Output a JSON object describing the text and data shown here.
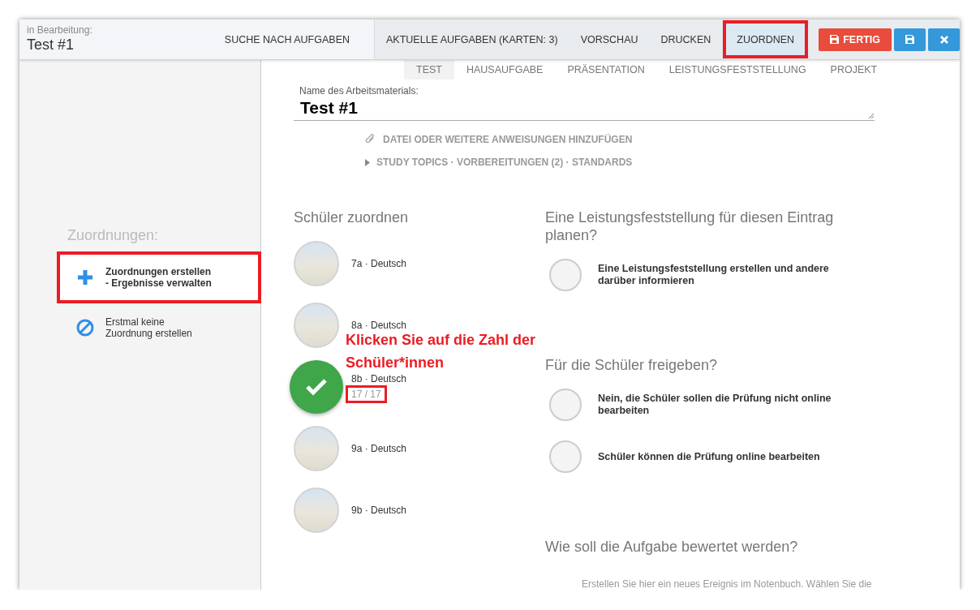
{
  "header": {
    "caption": "in Bearbeitung:",
    "title": "Test #1"
  },
  "nav": [
    {
      "label": "SUCHE NACH AUFGABEN",
      "selected": false,
      "highlighted": false
    },
    {
      "label": "AKTUELLE AUFGABEN (KARTEN: 3)",
      "selected": false,
      "highlighted": false
    },
    {
      "label": "VORSCHAU",
      "selected": false,
      "highlighted": false
    },
    {
      "label": "DRUCKEN",
      "selected": false,
      "highlighted": false
    },
    {
      "label": "ZUORDNEN",
      "selected": true,
      "highlighted": true
    }
  ],
  "actions": [
    {
      "kind": "finish",
      "label": "FERTIG"
    },
    {
      "kind": "save"
    },
    {
      "kind": "close"
    }
  ],
  "subtabs": [
    {
      "label": "TEST",
      "selected": true
    },
    {
      "label": "HAUSAUFGABE",
      "selected": false
    },
    {
      "label": "PRÄSENTATION",
      "selected": false
    },
    {
      "label": "LEISTUNGSFESTSTELLUNG",
      "selected": false
    },
    {
      "label": "PROJEKT",
      "selected": false
    }
  ],
  "material": {
    "label": "Name des Arbeitsmaterials:",
    "value": "Test #1",
    "attach": "DATEI ODER WEITERE ANWEISUNGEN HINZUFÜGEN",
    "topics": "STUDY TOPICS · VORBEREITUNGEN (2) · STANDARDS"
  },
  "sidebar": {
    "heading": "Zuordnungen:",
    "items": [
      {
        "kind": "create",
        "lines": [
          "Zuordnungen erstellen",
          "- Ergebnisse verwalten"
        ],
        "selected": true,
        "highlighted": true
      },
      {
        "kind": "none",
        "lines": [
          "Erstmal keine",
          "Zuordnung erstellen"
        ],
        "selected": false,
        "highlighted": false
      }
    ]
  },
  "students": {
    "heading": "Schüler zuordnen",
    "rows": [
      {
        "label": "7a · Deutsch",
        "selected": false
      },
      {
        "label": "8a · Deutsch",
        "selected": false
      },
      {
        "label": "8b · Deutsch",
        "selected": true,
        "count": "17 / 17",
        "highlighted": true
      },
      {
        "label": "9a · Deutsch",
        "selected": false
      },
      {
        "label": "9b · Deutsch",
        "selected": false
      }
    ]
  },
  "annotation": "Klicken Sie auf die Zahl der Schüler*innen",
  "sections": [
    {
      "heading": "Eine Leistungsfeststellung für diesen Eintrag planen?",
      "options": [
        {
          "label": "Eine Leistungsfeststellung erstellen und andere darüber informieren",
          "selected": false
        }
      ]
    },
    {
      "heading": "Für die Schüler freigeben?",
      "options": [
        {
          "label": "Nein, die Schüler sollen die Prüfung nicht online bearbeiten",
          "selected": false
        },
        {
          "label": "Schüler können die Prüfung online bearbeiten",
          "selected": false
        }
      ]
    },
    {
      "heading": "Wie soll die Aufgabe bewertet werden?",
      "note": "Erstellen Sie hier ein neues Ereignis im Notenbuch. Wählen Sie die"
    }
  ]
}
